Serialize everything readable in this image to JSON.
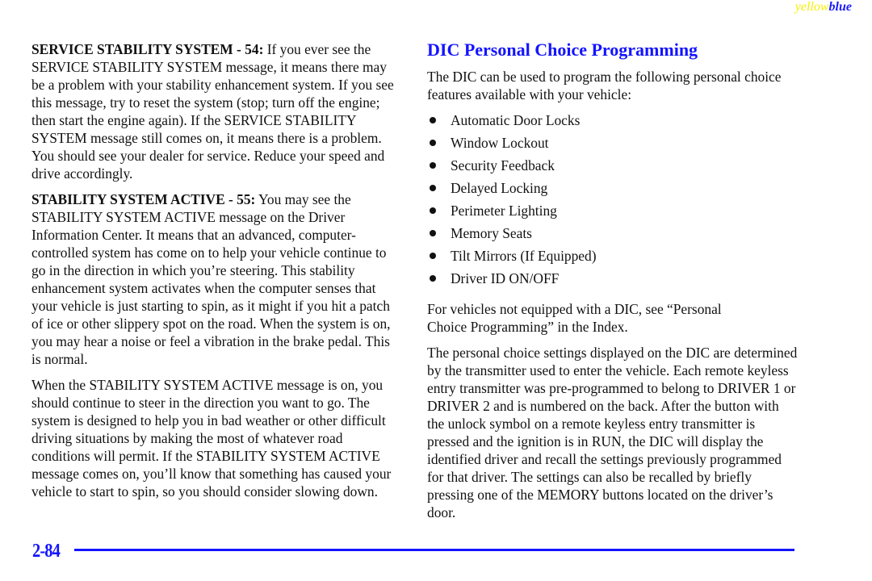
{
  "header": {
    "mark_yellow": "yellow",
    "mark_blue": "blue"
  },
  "left": {
    "p1": {
      "lead": "SERVICE STABILITY SYSTEM - 54:",
      "text": " If you ever see the SERVICE STABILITY SYSTEM message, it means there may be a problem with your stability enhancement system. If you see this message, try to reset the system (stop; turn off the engine; then start the engine again). If the SERVICE STABILITY SYSTEM message still comes on, it means there is a problem. You should see your dealer for service. Reduce your speed and drive accordingly."
    },
    "p2": {
      "lead": "STABILITY SYSTEM ACTIVE - 55:",
      "text": " You may see the STABILITY SYSTEM ACTIVE message on the Driver Information Center. It means that an advanced, computer-controlled system has come on to help your vehicle continue to go in the direction in which you’re steering. This stability enhancement system activates when the computer senses that your vehicle is just starting to spin, as it might if you hit a patch of ice or other slippery spot on the road. When the system is on, you may hear a noise or feel a vibration in the brake pedal. This is normal."
    },
    "p3": "When the STABILITY SYSTEM ACTIVE message is on, you should continue to steer in the direction you want to go. The system is designed to help you in bad weather or other difficult driving situations by making the most of whatever road conditions will permit. If the STABILITY SYSTEM ACTIVE message comes on, you’ll know that something has caused your vehicle to start to spin, so you should consider slowing down."
  },
  "right": {
    "heading": "DIC Personal Choice Programming",
    "intro": "The DIC can be used to program the following personal choice features available with your vehicle:",
    "features": [
      "Automatic Door Locks",
      "Window Lockout",
      "Security Feedback",
      "Delayed Locking",
      "Perimeter Lighting",
      "Memory Seats",
      "Tilt Mirrors (If Equipped)",
      "Driver ID ON/OFF"
    ],
    "p_not_equipped": "For vehicles not equipped with a DIC, see “Personal Choice Programming” in the Index.",
    "p_settings": "The personal choice settings displayed on the DIC are determined by the transmitter used to enter the vehicle. Each remote keyless entry transmitter was pre-programmed to belong to DRIVER 1 or DRIVER 2 and is numbered on the back. After the button with the unlock symbol on a remote keyless entry transmitter is pressed and the ignition is in RUN, the DIC will display the identified driver and recall the settings previously programmed for that driver. The settings can also be recalled by briefly pressing one of the MEMORY buttons located on the driver’s door."
  },
  "footer": {
    "page_number": "2-84"
  },
  "colors": {
    "accent_blue": "#1414ff",
    "mark_yellow": "#f5f000"
  }
}
